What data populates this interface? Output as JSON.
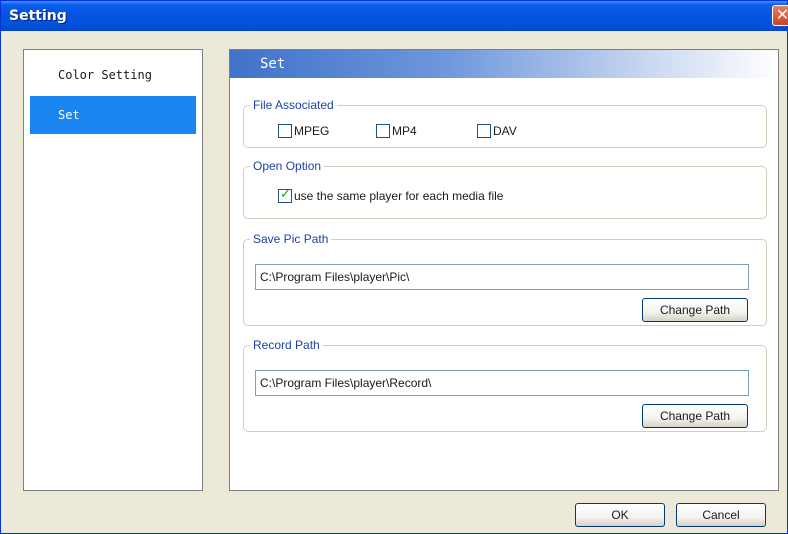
{
  "window": {
    "title": "Setting",
    "close_symbol": "✕"
  },
  "sidebar": {
    "items": [
      {
        "label": "Color Setting",
        "selected": false
      },
      {
        "label": "Set",
        "selected": true
      }
    ]
  },
  "panel": {
    "header": "Set",
    "file_associated": {
      "label": "File Associated",
      "options": [
        {
          "label": "MPEG",
          "checked": false
        },
        {
          "label": "MP4",
          "checked": false
        },
        {
          "label": "DAV",
          "checked": false
        }
      ]
    },
    "open_option": {
      "label": "Open Option",
      "option_label": "use the same player for each media file",
      "checked": true
    },
    "save_pic_path": {
      "label": "Save Pic Path",
      "value": "C:\\Program Files\\player\\Pic\\",
      "button": "Change Path"
    },
    "record_path": {
      "label": "Record Path",
      "value": "C:\\Program Files\\player\\Record\\",
      "button": "Change Path"
    }
  },
  "footer": {
    "ok": "OK",
    "cancel": "Cancel"
  },
  "colors": {
    "titlebar": "#0554e3",
    "selection": "#1b86f1",
    "group_label": "#1f3fa8",
    "check": "#21a121"
  }
}
